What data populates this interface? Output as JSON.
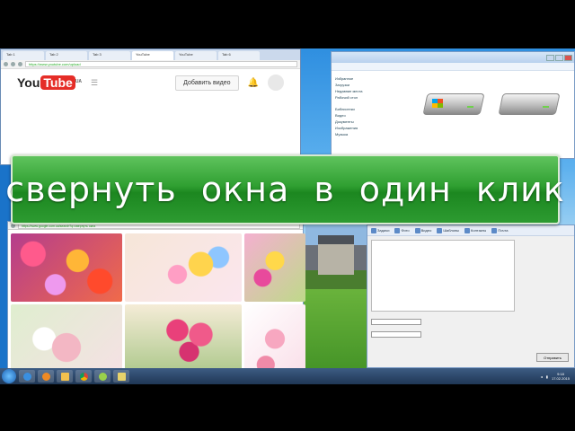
{
  "banner": {
    "text": "свернуть окна в один клик"
  },
  "youtube_window": {
    "tabs": [
      "Tab 1",
      "Tab 2",
      "Tab 3",
      "YouTube",
      "YouTube",
      "Tab 6"
    ],
    "address": "https://www.youtube.com/upload",
    "logo_you": "You",
    "logo_tube": "Tube",
    "logo_region": "UA",
    "upload_button": "Добавить видео"
  },
  "explorer_window": {
    "sidebar": [
      "Избранное",
      "Загрузки",
      "Недавние места",
      "Рабочий стол",
      "Библиотеки",
      "Видео",
      "Документы",
      "Изображения",
      "Музыка"
    ]
  },
  "images_window": {
    "address": "https://www.google.com.ua/search?q=свернуть окна"
  },
  "mail_window": {
    "toolbar": [
      "Задачи",
      "Фото",
      "Видео",
      "Шаблоны",
      "Контакты",
      "Почта"
    ],
    "button_send": "Отправить"
  },
  "taskbar": {
    "time": "9:18",
    "date": "17.02.2015"
  },
  "colors": {
    "banner_green": "#2f9f31",
    "youtube_red": "#e52d27",
    "taskbar": "#1f3755"
  }
}
